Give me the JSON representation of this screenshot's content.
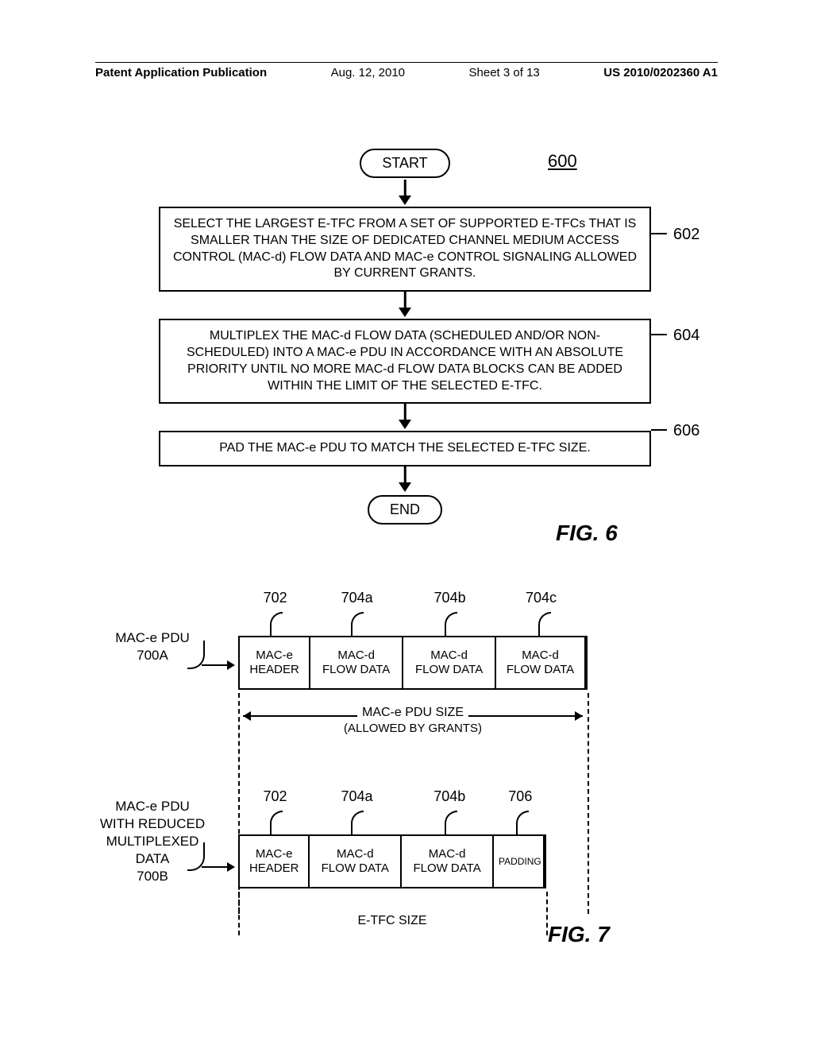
{
  "header": {
    "publication": "Patent Application Publication",
    "date": "Aug. 12, 2010",
    "sheet": "Sheet 3 of 13",
    "pubno": "US 2010/0202360 A1"
  },
  "fig6": {
    "label": "FIG. 6",
    "ref": "600",
    "start": "START",
    "end": "END",
    "steps": [
      {
        "ref": "602",
        "text": "SELECT THE LARGEST E-TFC FROM A SET OF SUPPORTED E-TFCs THAT IS SMALLER THAN THE SIZE OF DEDICATED CHANNEL MEDIUM ACCESS CONTROL (MAC-d) FLOW DATA AND MAC-e CONTROL SIGNALING ALLOWED BY CURRENT GRANTS."
      },
      {
        "ref": "604",
        "text": "MULTIPLEX THE MAC-d FLOW DATA (SCHEDULED AND/OR NON-SCHEDULED) INTO A MAC-e PDU IN ACCORDANCE WITH AN ABSOLUTE PRIORITY UNTIL NO MORE MAC-d FLOW DATA BLOCKS CAN BE ADDED WITHIN THE LIMIT OF THE SELECTED E-TFC."
      },
      {
        "ref": "606",
        "text": "PAD THE MAC-e PDU TO MATCH THE SELECTED E-TFC SIZE."
      }
    ]
  },
  "fig7": {
    "label": "FIG. 7",
    "rowA": {
      "side_label_l1": "MAC-e PDU",
      "side_label_l2": "700A",
      "leads": [
        "702",
        "704a",
        "704b",
        "704c"
      ],
      "cells": [
        {
          "l1": "MAC-e",
          "l2": "HEADER"
        },
        {
          "l1": "MAC-d",
          "l2": "FLOW DATA"
        },
        {
          "l1": "MAC-d",
          "l2": "FLOW DATA"
        },
        {
          "l1": "MAC-d",
          "l2": "FLOW DATA"
        }
      ],
      "dim_text": "MAC-e PDU SIZE",
      "dim_sub": "(ALLOWED BY GRANTS)"
    },
    "rowB": {
      "side_label_l1": "MAC-e PDU",
      "side_label_l2": "WITH REDUCED",
      "side_label_l3": "MULTIPLEXED",
      "side_label_l4": "DATA",
      "side_label_l5": "700B",
      "leads": [
        "702",
        "704a",
        "704b",
        "706"
      ],
      "cells": [
        {
          "l1": "MAC-e",
          "l2": "HEADER"
        },
        {
          "l1": "MAC-d",
          "l2": "FLOW DATA"
        },
        {
          "l1": "MAC-d",
          "l2": "FLOW DATA"
        },
        {
          "l1": "PADDING",
          "l2": ""
        }
      ],
      "dim_text": "E-TFC SIZE"
    }
  }
}
